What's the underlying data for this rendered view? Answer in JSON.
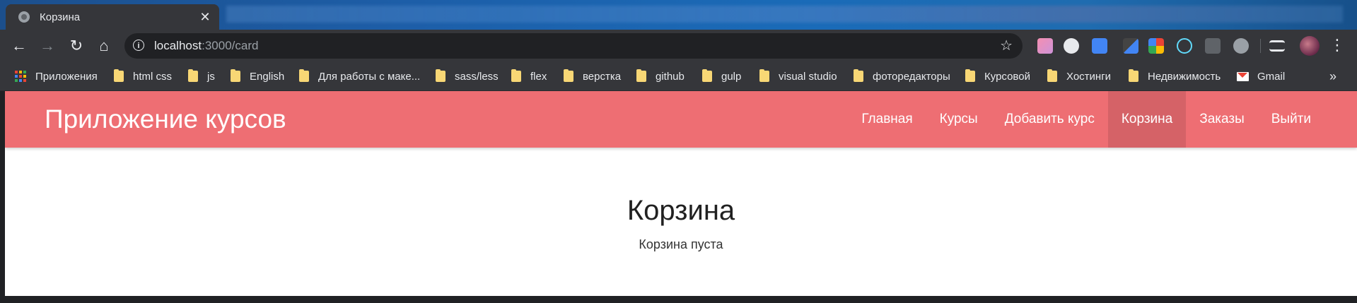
{
  "browser": {
    "tab": {
      "title": "Корзина",
      "close_glyph": "✕",
      "favicon": "globe-icon"
    },
    "toolbar": {
      "back_glyph": "←",
      "forward_glyph": "→",
      "reload_glyph": "↻",
      "home_glyph": "⌂",
      "info_glyph": "i",
      "url_host": "localhost",
      "url_path": ":3000/card",
      "star_glyph": "☆",
      "menu_glyph": "⋮"
    },
    "bookmarks": {
      "items": [
        {
          "label": "Приложения",
          "icon": "apps-grid-icon"
        },
        {
          "label": "html css",
          "icon": "folder-icon"
        },
        {
          "label": "js",
          "icon": "folder-icon"
        },
        {
          "label": "English",
          "icon": "folder-icon"
        },
        {
          "label": "Для работы с маке...",
          "icon": "folder-icon"
        },
        {
          "label": "sass/less",
          "icon": "folder-icon"
        },
        {
          "label": "flex",
          "icon": "folder-icon"
        },
        {
          "label": "верстка",
          "icon": "folder-icon"
        },
        {
          "label": "github",
          "icon": "folder-icon"
        },
        {
          "label": "gulp",
          "icon": "folder-icon"
        },
        {
          "label": "visual studio",
          "icon": "folder-icon"
        },
        {
          "label": "фоторедакторы",
          "icon": "folder-icon"
        },
        {
          "label": "Курсовой",
          "icon": "folder-icon"
        },
        {
          "label": "Хостинги",
          "icon": "folder-icon"
        },
        {
          "label": "Недвижимость",
          "icon": "folder-icon"
        },
        {
          "label": "Gmail",
          "icon": "gmail-icon"
        }
      ],
      "more_glyph": "»"
    }
  },
  "site": {
    "brand": "Приложение курсов",
    "nav": [
      {
        "label": "Главная"
      },
      {
        "label": "Курсы"
      },
      {
        "label": "Добавить курс"
      },
      {
        "label": "Корзина",
        "active": true
      },
      {
        "label": "Заказы"
      },
      {
        "label": "Выйти"
      }
    ],
    "nav_color": "#ee6e73"
  },
  "page": {
    "heading": "Корзина",
    "empty_message": "Корзина пуста"
  }
}
